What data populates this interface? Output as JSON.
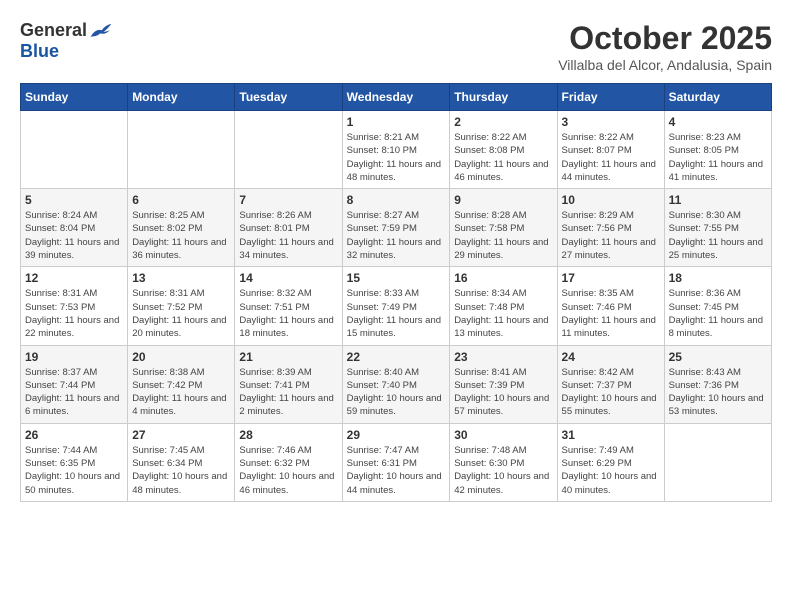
{
  "logo": {
    "general": "General",
    "blue": "Blue"
  },
  "title": "October 2025",
  "location": "Villalba del Alcor, Andalusia, Spain",
  "days_of_week": [
    "Sunday",
    "Monday",
    "Tuesday",
    "Wednesday",
    "Thursday",
    "Friday",
    "Saturday"
  ],
  "weeks": [
    [
      {
        "day": "",
        "info": ""
      },
      {
        "day": "",
        "info": ""
      },
      {
        "day": "",
        "info": ""
      },
      {
        "day": "1",
        "info": "Sunrise: 8:21 AM\nSunset: 8:10 PM\nDaylight: 11 hours and 48 minutes."
      },
      {
        "day": "2",
        "info": "Sunrise: 8:22 AM\nSunset: 8:08 PM\nDaylight: 11 hours and 46 minutes."
      },
      {
        "day": "3",
        "info": "Sunrise: 8:22 AM\nSunset: 8:07 PM\nDaylight: 11 hours and 44 minutes."
      },
      {
        "day": "4",
        "info": "Sunrise: 8:23 AM\nSunset: 8:05 PM\nDaylight: 11 hours and 41 minutes."
      }
    ],
    [
      {
        "day": "5",
        "info": "Sunrise: 8:24 AM\nSunset: 8:04 PM\nDaylight: 11 hours and 39 minutes."
      },
      {
        "day": "6",
        "info": "Sunrise: 8:25 AM\nSunset: 8:02 PM\nDaylight: 11 hours and 36 minutes."
      },
      {
        "day": "7",
        "info": "Sunrise: 8:26 AM\nSunset: 8:01 PM\nDaylight: 11 hours and 34 minutes."
      },
      {
        "day": "8",
        "info": "Sunrise: 8:27 AM\nSunset: 7:59 PM\nDaylight: 11 hours and 32 minutes."
      },
      {
        "day": "9",
        "info": "Sunrise: 8:28 AM\nSunset: 7:58 PM\nDaylight: 11 hours and 29 minutes."
      },
      {
        "day": "10",
        "info": "Sunrise: 8:29 AM\nSunset: 7:56 PM\nDaylight: 11 hours and 27 minutes."
      },
      {
        "day": "11",
        "info": "Sunrise: 8:30 AM\nSunset: 7:55 PM\nDaylight: 11 hours and 25 minutes."
      }
    ],
    [
      {
        "day": "12",
        "info": "Sunrise: 8:31 AM\nSunset: 7:53 PM\nDaylight: 11 hours and 22 minutes."
      },
      {
        "day": "13",
        "info": "Sunrise: 8:31 AM\nSunset: 7:52 PM\nDaylight: 11 hours and 20 minutes."
      },
      {
        "day": "14",
        "info": "Sunrise: 8:32 AM\nSunset: 7:51 PM\nDaylight: 11 hours and 18 minutes."
      },
      {
        "day": "15",
        "info": "Sunrise: 8:33 AM\nSunset: 7:49 PM\nDaylight: 11 hours and 15 minutes."
      },
      {
        "day": "16",
        "info": "Sunrise: 8:34 AM\nSunset: 7:48 PM\nDaylight: 11 hours and 13 minutes."
      },
      {
        "day": "17",
        "info": "Sunrise: 8:35 AM\nSunset: 7:46 PM\nDaylight: 11 hours and 11 minutes."
      },
      {
        "day": "18",
        "info": "Sunrise: 8:36 AM\nSunset: 7:45 PM\nDaylight: 11 hours and 8 minutes."
      }
    ],
    [
      {
        "day": "19",
        "info": "Sunrise: 8:37 AM\nSunset: 7:44 PM\nDaylight: 11 hours and 6 minutes."
      },
      {
        "day": "20",
        "info": "Sunrise: 8:38 AM\nSunset: 7:42 PM\nDaylight: 11 hours and 4 minutes."
      },
      {
        "day": "21",
        "info": "Sunrise: 8:39 AM\nSunset: 7:41 PM\nDaylight: 11 hours and 2 minutes."
      },
      {
        "day": "22",
        "info": "Sunrise: 8:40 AM\nSunset: 7:40 PM\nDaylight: 10 hours and 59 minutes."
      },
      {
        "day": "23",
        "info": "Sunrise: 8:41 AM\nSunset: 7:39 PM\nDaylight: 10 hours and 57 minutes."
      },
      {
        "day": "24",
        "info": "Sunrise: 8:42 AM\nSunset: 7:37 PM\nDaylight: 10 hours and 55 minutes."
      },
      {
        "day": "25",
        "info": "Sunrise: 8:43 AM\nSunset: 7:36 PM\nDaylight: 10 hours and 53 minutes."
      }
    ],
    [
      {
        "day": "26",
        "info": "Sunrise: 7:44 AM\nSunset: 6:35 PM\nDaylight: 10 hours and 50 minutes."
      },
      {
        "day": "27",
        "info": "Sunrise: 7:45 AM\nSunset: 6:34 PM\nDaylight: 10 hours and 48 minutes."
      },
      {
        "day": "28",
        "info": "Sunrise: 7:46 AM\nSunset: 6:32 PM\nDaylight: 10 hours and 46 minutes."
      },
      {
        "day": "29",
        "info": "Sunrise: 7:47 AM\nSunset: 6:31 PM\nDaylight: 10 hours and 44 minutes."
      },
      {
        "day": "30",
        "info": "Sunrise: 7:48 AM\nSunset: 6:30 PM\nDaylight: 10 hours and 42 minutes."
      },
      {
        "day": "31",
        "info": "Sunrise: 7:49 AM\nSunset: 6:29 PM\nDaylight: 10 hours and 40 minutes."
      },
      {
        "day": "",
        "info": ""
      }
    ]
  ]
}
